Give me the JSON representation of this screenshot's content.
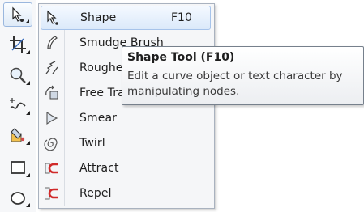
{
  "toolbox": {
    "tools": [
      {
        "name": "shape-tool",
        "icon": "shape-tool-icon",
        "active": true
      },
      {
        "name": "crop-tool",
        "icon": "crop-tool-icon",
        "active": false
      },
      {
        "name": "zoom-tool",
        "icon": "zoom-tool-icon",
        "active": false
      },
      {
        "name": "freehand-tool",
        "icon": "freehand-tool-icon",
        "active": false
      },
      {
        "name": "smart-fill-tool",
        "icon": "smart-fill-tool-icon",
        "active": false
      },
      {
        "name": "rectangle-tool",
        "icon": "rectangle-tool-icon",
        "active": false
      },
      {
        "name": "ellipse-tool",
        "icon": "ellipse-tool-icon",
        "active": false
      }
    ]
  },
  "menu": {
    "items": [
      {
        "label": "Shape",
        "shortcut": "F10",
        "icon": "shape-icon",
        "selected": true
      },
      {
        "label": "Smudge Brush",
        "shortcut": "",
        "icon": "smudge-brush-icon",
        "selected": false
      },
      {
        "label": "Roughen Brush",
        "shortcut": "",
        "icon": "roughen-brush-icon",
        "selected": false
      },
      {
        "label": "Free Transform",
        "shortcut": "",
        "icon": "free-transform-icon",
        "selected": false
      },
      {
        "label": "Smear",
        "shortcut": "",
        "icon": "smear-icon",
        "selected": false
      },
      {
        "label": "Twirl",
        "shortcut": "",
        "icon": "twirl-icon",
        "selected": false
      },
      {
        "label": "Attract",
        "shortcut": "",
        "icon": "attract-icon",
        "selected": false
      },
      {
        "label": "Repel",
        "shortcut": "",
        "icon": "repel-icon",
        "selected": false
      }
    ]
  },
  "tooltip": {
    "title": "Shape Tool (F10)",
    "description": "Edit a curve object or text character by manipulating nodes."
  },
  "colors": {
    "selection_border": "#a6c3ea",
    "selection_fill": "#dbe9fa",
    "magnet_red": "#d02a2a"
  }
}
